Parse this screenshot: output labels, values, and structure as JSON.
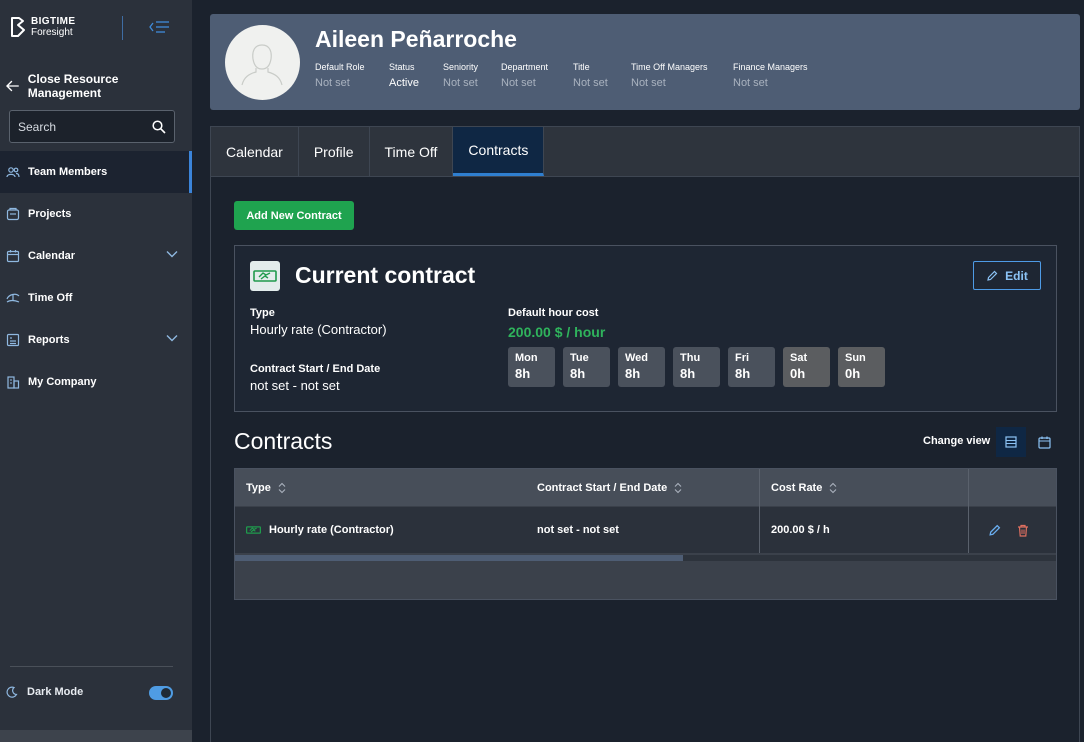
{
  "sidebar": {
    "logo_line1": "BIGTIME",
    "logo_line2": "Foresight",
    "close_label": "Close Resource Management",
    "search_placeholder": "Search",
    "items": [
      {
        "label": "Team Members",
        "icon": "team-icon",
        "active": true
      },
      {
        "label": "Projects",
        "icon": "projects-icon"
      },
      {
        "label": "Calendar",
        "icon": "calendar-icon",
        "expandable": true
      },
      {
        "label": "Time Off",
        "icon": "time-off-icon"
      },
      {
        "label": "Reports",
        "icon": "reports-icon",
        "expandable": true
      },
      {
        "label": "My Company",
        "icon": "company-icon"
      }
    ],
    "dark_mode_label": "Dark Mode",
    "dark_mode_on": true
  },
  "header": {
    "name": "Aileen Peñarroche",
    "fields": [
      {
        "label": "Default Role",
        "value": "Not set"
      },
      {
        "label": "Status",
        "value": "Active"
      },
      {
        "label": "Seniority",
        "value": "Not set"
      },
      {
        "label": "Department",
        "value": "Not set"
      },
      {
        "label": "Title",
        "value": "Not set"
      },
      {
        "label": "Time Off Managers",
        "value": "Not set"
      },
      {
        "label": "Finance Managers",
        "value": "Not set"
      }
    ]
  },
  "tabs": [
    {
      "label": "Calendar"
    },
    {
      "label": "Profile"
    },
    {
      "label": "Time Off"
    },
    {
      "label": "Contracts",
      "active": true
    }
  ],
  "add_contract_label": "Add New Contract",
  "current_contract": {
    "title": "Current contract",
    "edit_label": "Edit",
    "type_label": "Type",
    "type_value": "Hourly rate (Contractor)",
    "dates_label": "Contract Start / End Date",
    "dates_value": "not set - not set",
    "cost_label": "Default hour cost",
    "cost_value": "200.00 $ / hour",
    "days": [
      {
        "day": "Mon",
        "hours": "8h"
      },
      {
        "day": "Tue",
        "hours": "8h"
      },
      {
        "day": "Wed",
        "hours": "8h"
      },
      {
        "day": "Thu",
        "hours": "8h"
      },
      {
        "day": "Fri",
        "hours": "8h"
      },
      {
        "day": "Sat",
        "hours": "0h"
      },
      {
        "day": "Sun",
        "hours": "0h"
      }
    ]
  },
  "contracts": {
    "title": "Contracts",
    "change_view_label": "Change view",
    "columns": [
      "Type",
      "Contract Start / End Date",
      "Cost Rate"
    ],
    "rows": [
      {
        "type": "Hourly rate (Contractor)",
        "dates": "not set - not set",
        "cost_rate": "200.00 $ / h"
      }
    ]
  },
  "colors": {
    "accent_green": "#1fa34f",
    "cost_green": "#2fb35c",
    "accent_blue": "#2f7fd0",
    "header_bg": "#4e5d74"
  }
}
